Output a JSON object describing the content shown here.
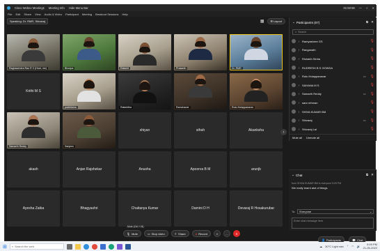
{
  "titlebar": {
    "app_title": "Cisco Webex Meetings",
    "meeting_info": "Meeting Info",
    "hide_menu_bar": "Hide Menu Bar",
    "timer": "01:50:58",
    "window_buttons": [
      "—",
      "□",
      "✕"
    ]
  },
  "menubar": [
    "File",
    "Edit",
    "Share",
    "View",
    "Audio & Video",
    "Participant",
    "Meeting",
    "Breakout Sessions",
    "Help"
  ],
  "speaking": "Speaking: Dr. RMR, Shivaraj",
  "layout_label": "Layout",
  "tiles_video": [
    {
      "name": "Raghavendra Rao R V (Host, me)",
      "bg": "bg1"
    },
    {
      "name": "Bhoopa",
      "bg": "bg2"
    },
    {
      "name": "Rakshit",
      "bg": "bg3"
    },
    {
      "name": "Prasanth",
      "bg": "bg4"
    },
    {
      "name": "Dr. RMR",
      "bg": "bg5"
    },
    {
      "name": "prathiksha",
      "bg": "bg3"
    },
    {
      "name": "Rakshitha",
      "bg": "bg6"
    },
    {
      "name": "Ramchandr",
      "bg": "bg7"
    },
    {
      "name": "Rutu Holappanavar",
      "bg": "bg8"
    },
    {
      "name": "Samarth Reddy",
      "bg": "bg9"
    },
    {
      "name": "Sanjeev",
      "bg": "bg10"
    }
  ],
  "tile_krithi": "Krithi M S",
  "tiles_text": [
    "shiyan",
    "sifrah",
    "Akanksha",
    "akash",
    "Anjan Rajshekar",
    "Anusha",
    "Apoorva B M",
    "arunjb",
    "Ayesha Zaiba",
    "Bhagyashri",
    "Chaitanya Kumar",
    "Damini D H",
    "Devaraj R Hosakurubar"
  ],
  "participants": {
    "title": "Participants (67)",
    "search_placeholder": "Search",
    "list": [
      {
        "name": "Ramyashree GS",
        "cam": false
      },
      {
        "name": "Ranganath",
        "cam": false
      },
      {
        "name": "Rishabh Sinha",
        "cam": false
      },
      {
        "name": "RUDRESH B S GOWDA",
        "cam": false
      },
      {
        "name": "Rutu Holappanavar",
        "cam": true
      },
      {
        "name": "SAHANA M S",
        "cam": false
      },
      {
        "name": "Samarth Reddy",
        "cam": true
      },
      {
        "name": "sara rehman",
        "cam": false
      },
      {
        "name": "SHIVA KUMAR BM",
        "cam": false
      },
      {
        "name": "Shivaraj",
        "cam": true
      },
      {
        "name": "Shivaraj Lal",
        "cam": false
      }
    ],
    "mute_all": "Mute all",
    "unmute_all": "Unmute all"
  },
  "chat": {
    "title": "Chat",
    "meta": "from SHIVA KUMAR BM to everyone   5:09 PM",
    "message": "We really learnt alot of things",
    "to_label": "To:",
    "to_value": "Everyone",
    "placeholder": "Enter chat message here"
  },
  "controls": {
    "mode_tip": "Mute (Ctrl + M)",
    "mute": "Mute",
    "stop_video": "Stop video",
    "share": "Share",
    "record": "Record",
    "participants": "Participants",
    "chat": "Chat"
  },
  "taskbar": {
    "search_placeholder": "Search the web",
    "weather": "30°C  Light rain",
    "time": "5:09 PM",
    "date": "21-05-2022"
  }
}
